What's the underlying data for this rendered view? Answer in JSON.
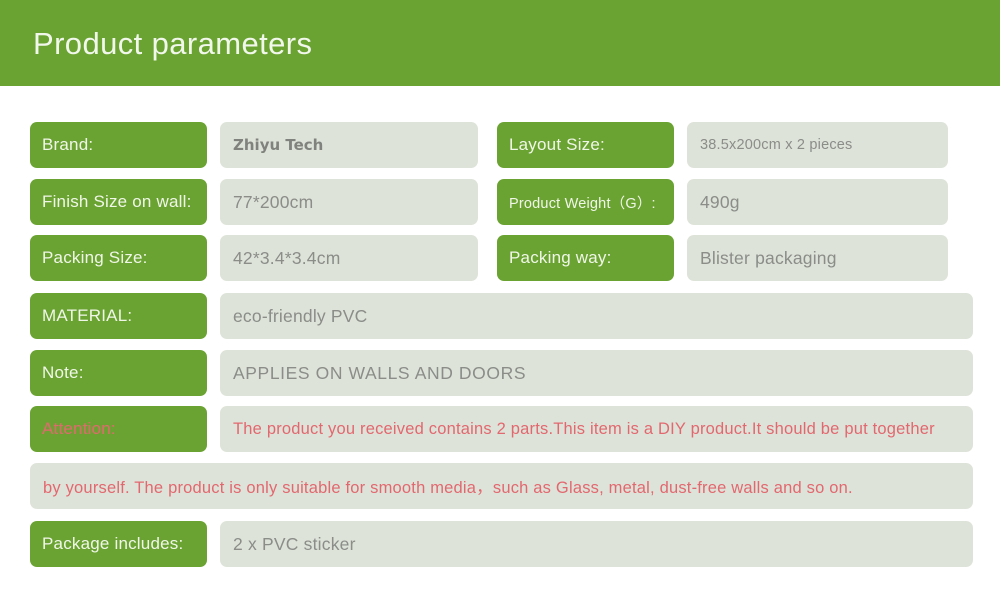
{
  "header": {
    "title": "Product parameters",
    "background_color": "#6aa332"
  },
  "colors": {
    "brand_green": "#6aa332",
    "label_text": "#f0f6e8",
    "value_background": "#dee3d9",
    "value_text": "#8a8d88",
    "attention_red": "#e2686f"
  },
  "rows": [
    {
      "left": {
        "label": "Brand:",
        "value": "Zhiyu Tech"
      },
      "right": {
        "label": "Layout Size:",
        "value": "38.5x200cm x 2 pieces"
      }
    },
    {
      "left": {
        "label": "Finish Size on wall:",
        "value": "77*200cm"
      },
      "right": {
        "label": "Product Weight（G）:",
        "value": "490g"
      }
    },
    {
      "left": {
        "label": "Packing Size:",
        "value": "42*3.4*3.4cm"
      },
      "right": {
        "label": "Packing way:",
        "value": "Blister packaging"
      }
    }
  ],
  "wide_rows": [
    {
      "label": "MATERIAL:",
      "value": "eco-friendly PVC"
    },
    {
      "label": "Note:",
      "value": "APPLIES ON WALLS AND DOORS"
    },
    {
      "label": "Attention:",
      "value": "The product you received contains 2 parts.This item is a DIY product.It should be put together"
    },
    {
      "label": "",
      "value": "by yourself. The product is only suitable for smooth media，such as Glass, metal, dust-free walls and so on."
    },
    {
      "label": "Package includes:",
      "value": "2 x PVC sticker"
    }
  ]
}
